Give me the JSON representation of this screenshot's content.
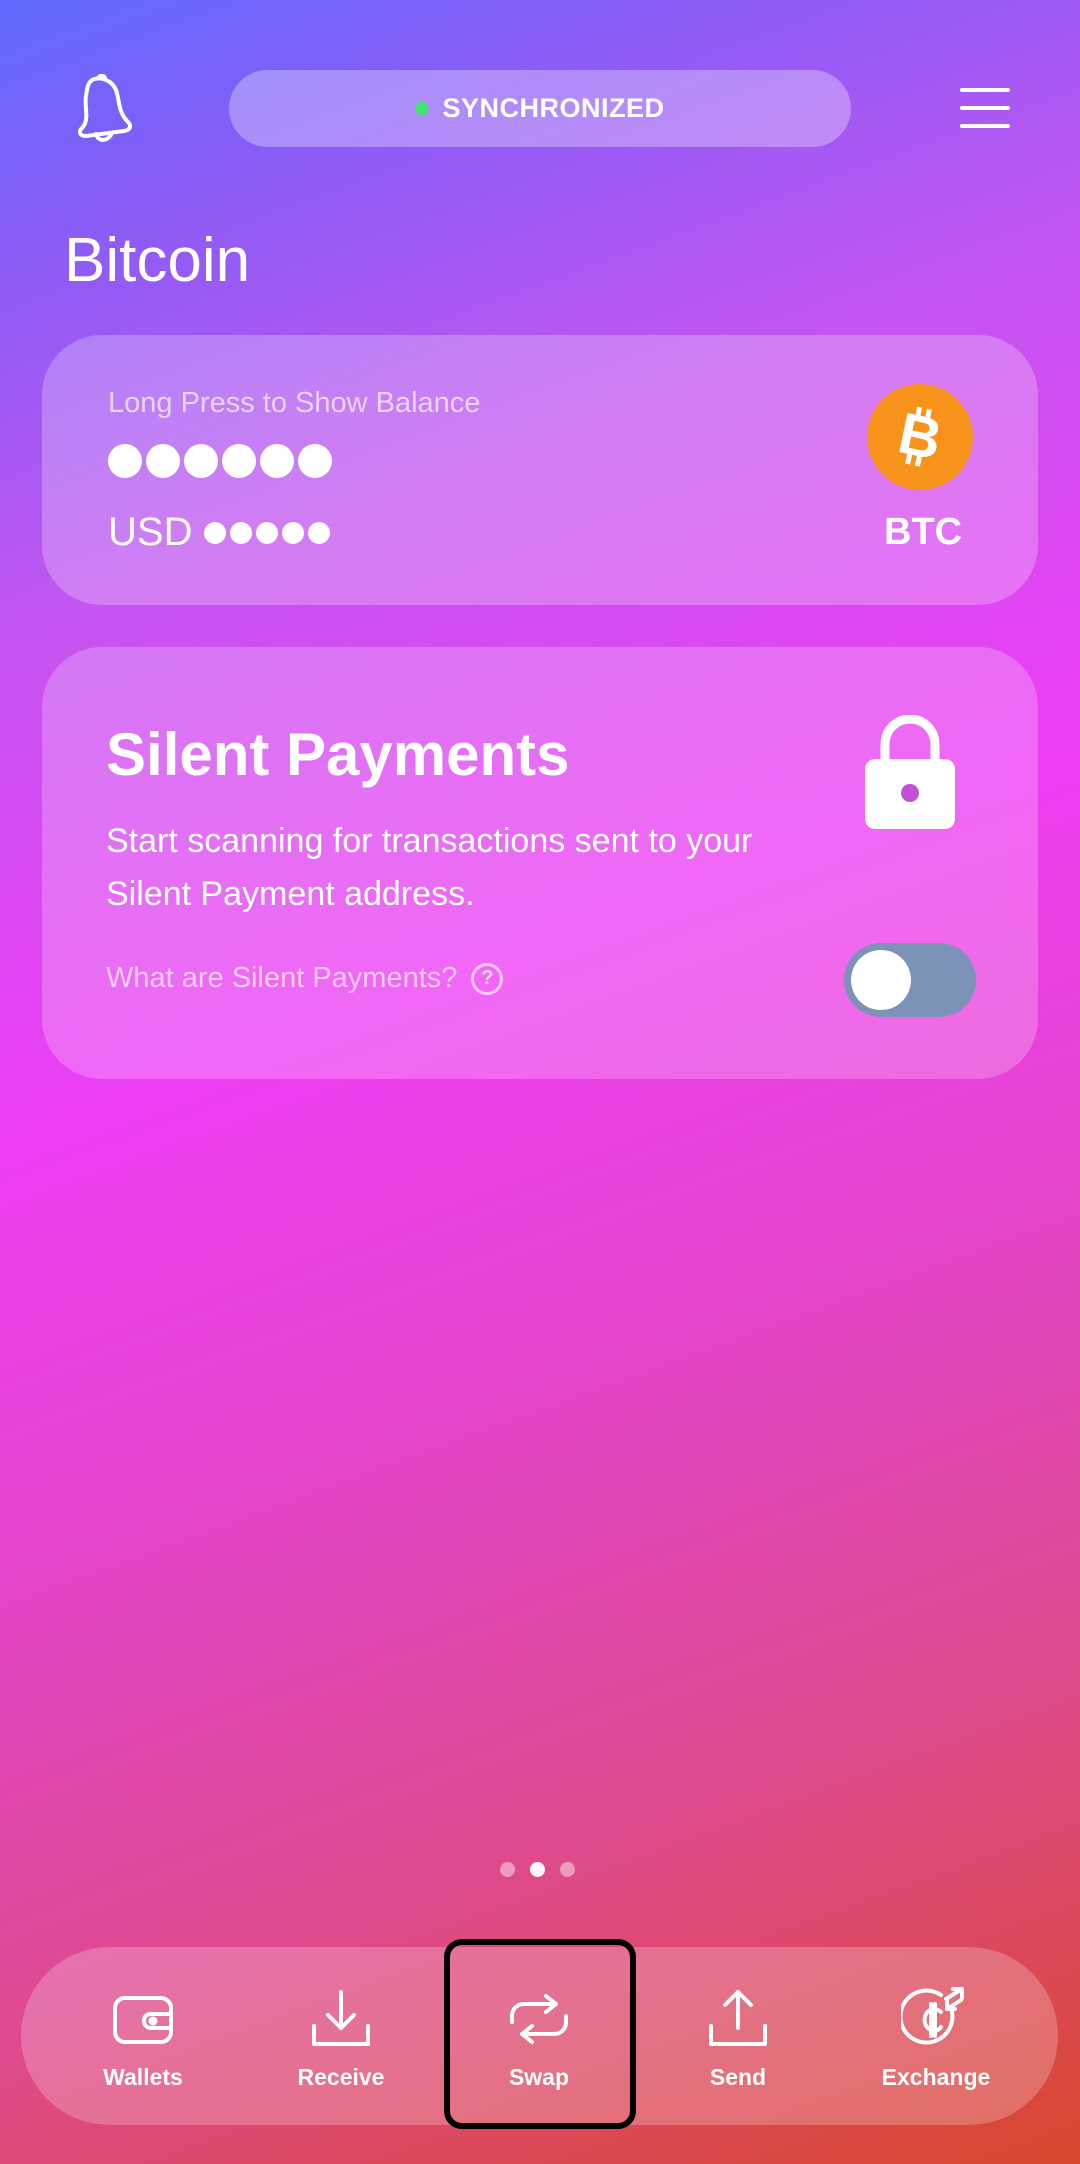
{
  "header": {
    "status_text": "SYNCHRONIZED",
    "status_color": "#3ee86a",
    "left_icon": "bell-icon",
    "right_icon": "menu-icon"
  },
  "page_title": "Bitcoin",
  "balance_card": {
    "hint": "Long Press to Show Balance",
    "usd_label": "USD",
    "currency_label": "BTC",
    "currency_icon": "bitcoin-icon",
    "currency_color": "#f7931a"
  },
  "silent_payments": {
    "title": "Silent Payments",
    "description": "Start scanning for transactions sent to your Silent Payment address.",
    "help_text": "What are Silent Payments?",
    "help_glyph": "?",
    "toggle_on": false,
    "lock_icon": "lock-icon"
  },
  "pager": {
    "count": 3,
    "active_index": 1
  },
  "bottom_nav": [
    {
      "label": "Wallets",
      "icon": "wallet-icon"
    },
    {
      "label": "Receive",
      "icon": "download-icon"
    },
    {
      "label": "Swap",
      "icon": "swap-icon"
    },
    {
      "label": "Send",
      "icon": "upload-icon"
    },
    {
      "label": "Exchange",
      "icon": "exchange-icon"
    }
  ]
}
